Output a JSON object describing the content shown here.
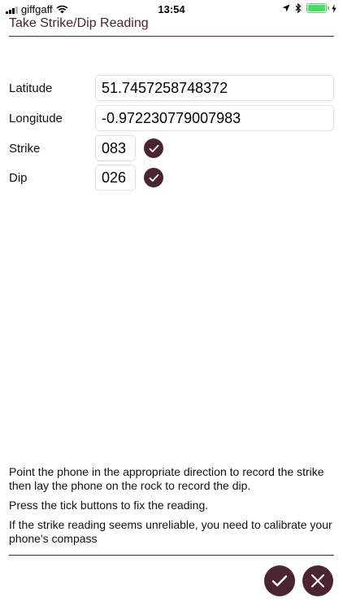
{
  "status_bar": {
    "carrier": "giffgaff",
    "time": "13:54"
  },
  "page": {
    "title": "Take Strike/Dip Reading"
  },
  "form": {
    "latitude": {
      "label": "Latitude",
      "value": "51.7457258748372"
    },
    "longitude": {
      "label": "Longitude",
      "value": "-0.972230779007983"
    },
    "strike": {
      "label": "Strike",
      "value": "083"
    },
    "dip": {
      "label": "Dip",
      "value": "026"
    }
  },
  "instructions": {
    "line1": "Point the phone in the appropriate direction to record the strike then lay the phone on the rock to record the dip.",
    "line2": "Press the tick buttons to fix the reading.",
    "line3": "If the strike reading seems unreliable, you need to calibrate your phone's compass"
  },
  "colors": {
    "accent": "#4a2530",
    "battery": "#4cd964"
  },
  "icons": {
    "confirm": "checkmark-icon",
    "cancel": "close-icon"
  }
}
